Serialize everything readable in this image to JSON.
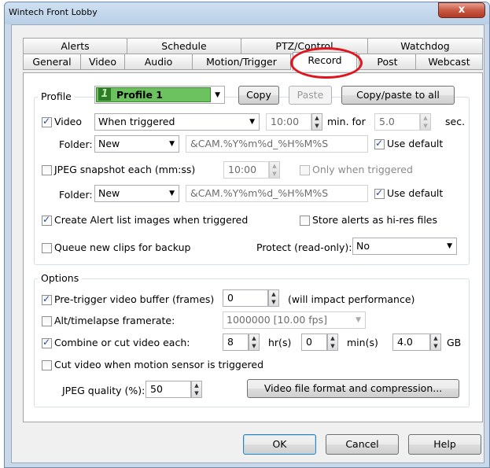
{
  "window": {
    "title": "Wintech Front Lobby",
    "close_label": "x"
  },
  "tabs_back": [
    "Alerts",
    "Schedule",
    "PTZ/Control",
    "Watchdog"
  ],
  "tabs_front": [
    "General",
    "Video",
    "Audio",
    "Motion/Trigger",
    "Record",
    "Post",
    "Webcast"
  ],
  "active_tab": "Record",
  "profile": {
    "label": "Profile",
    "value": "Profile 1",
    "copy": "Copy",
    "paste": "Paste",
    "copy_all": "Copy/paste to all"
  },
  "video": {
    "label": "Video",
    "mode": "When triggered",
    "time": "10:00",
    "minfor": "min. for",
    "secs": "5.0",
    "sec_label": "sec.",
    "folder_label": "Folder:",
    "folder": "New",
    "pattern": "&CAM.%Y%m%d_%H%M%S",
    "use_default": "Use default"
  },
  "jpeg": {
    "label": "JPEG snapshot each (mm:ss)",
    "time": "10:00",
    "only_trig": "Only when triggered",
    "folder_label": "Folder:",
    "folder": "New",
    "pattern": "&CAM.%Y%m%d_%H%M%S",
    "use_default": "Use default"
  },
  "alerts": {
    "create": "Create Alert list images when triggered",
    "hires": "Store alerts as hi-res files"
  },
  "queue": {
    "label": "Queue new clips for backup",
    "protect_label": "Protect (read-only):",
    "protect_value": "No"
  },
  "options": {
    "legend": "Options",
    "pretrigger": "Pre-trigger video buffer (frames)",
    "pretrigger_value": "0",
    "impact": "(will impact performance)",
    "alt": "Alt/timelapse framerate:",
    "alt_value": "1000000 [10.00 fps]",
    "combine": "Combine or cut video each:",
    "hr_value": "8",
    "hr_label": "hr(s)",
    "min_value": "0",
    "min_label": "min(s)",
    "gb_value": "4.0",
    "gb_label": "GB",
    "cut_motion": "Cut video when motion sensor is triggered",
    "jpeg_quality": "JPEG quality (%):",
    "jpeg_quality_value": "50",
    "format_btn": "Video file format and compression..."
  },
  "footer": {
    "ok": "OK",
    "cancel": "Cancel",
    "help": "Help"
  }
}
